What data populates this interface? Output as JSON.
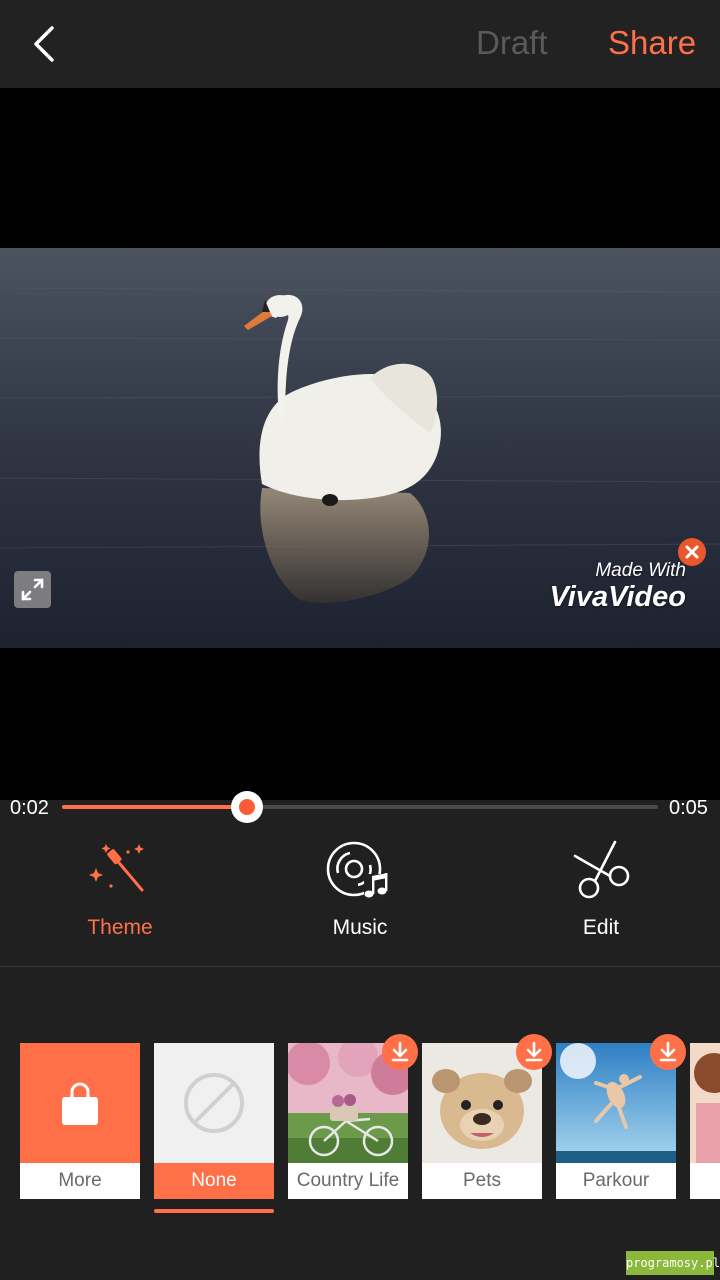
{
  "topbar": {
    "back_icon": "chevron-left-icon",
    "draft_label": "Draft",
    "share_label": "Share"
  },
  "player": {
    "watermark_line1": "Made With",
    "watermark_line2": "VivaVideo",
    "fullscreen_icon": "expand-icon",
    "watermark_close_icon": "close-icon"
  },
  "playback": {
    "current_time": "0:02",
    "total_time": "0:05",
    "progress": 0.31
  },
  "tabs": [
    {
      "label": "Theme",
      "icon": "magic-wand-icon",
      "active": true
    },
    {
      "label": "Music",
      "icon": "music-disc-icon",
      "active": false
    },
    {
      "label": "Edit",
      "icon": "scissors-icon",
      "active": false
    }
  ],
  "themes": [
    {
      "label": "More",
      "icon": "shopping-bag-icon"
    },
    {
      "label": "None",
      "icon": "none-icon",
      "selected": true
    },
    {
      "label": "Country Life",
      "download": true
    },
    {
      "label": "Pets",
      "download": true
    },
    {
      "label": "Parkour",
      "download": true
    }
  ],
  "colors": {
    "accent": "#ff7049",
    "background": "#202020",
    "topbar": "#222222"
  },
  "site_watermark": "programosy.pl"
}
